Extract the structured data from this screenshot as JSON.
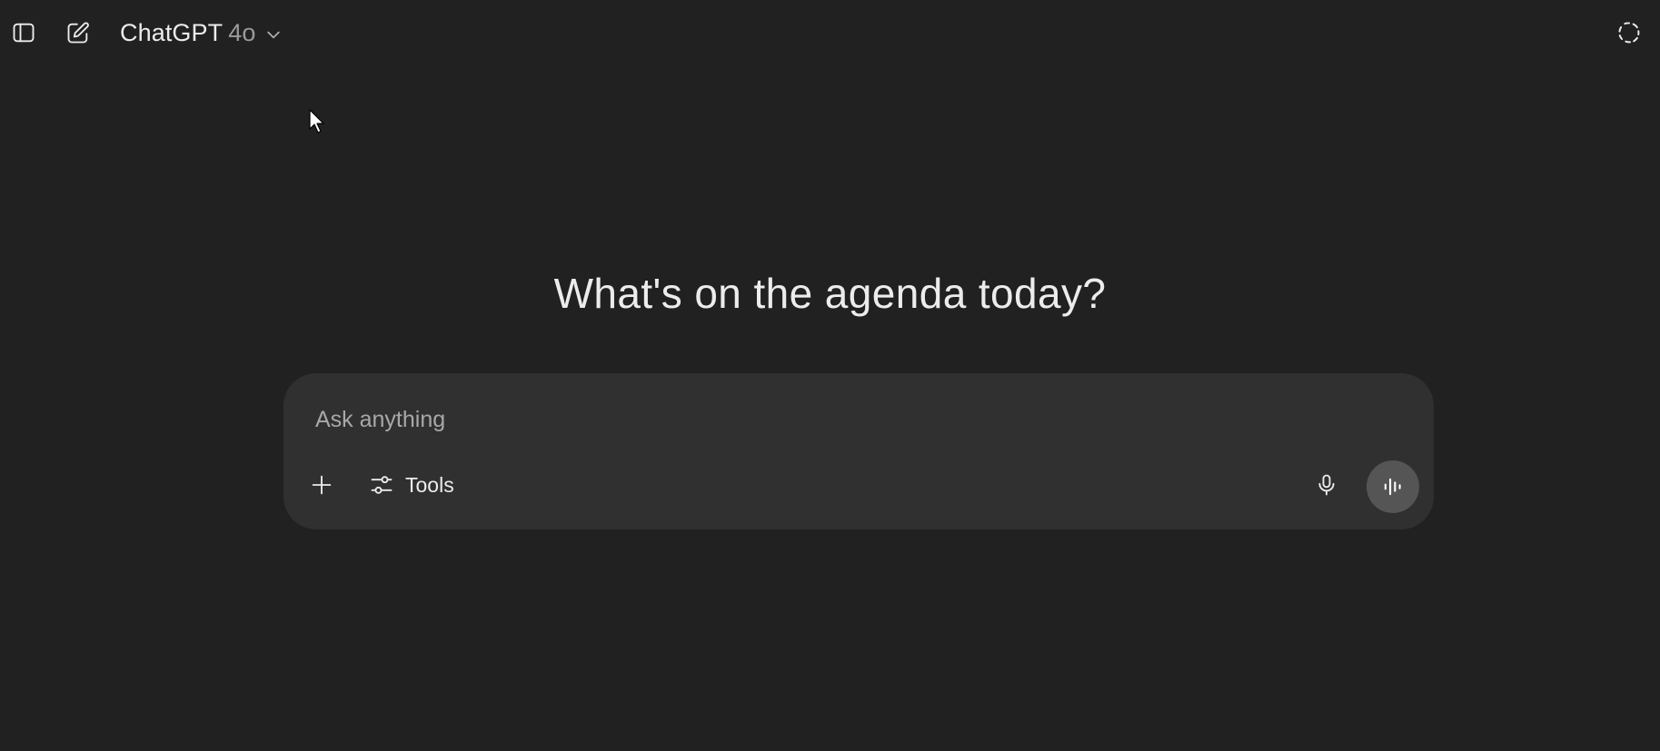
{
  "header": {
    "sidebar_toggle_icon": "sidebar-icon",
    "new_chat_icon": "edit-icon",
    "model_name": "ChatGPT",
    "model_version": "4o",
    "model_chevron_icon": "chevron-down-icon",
    "temporary_chat_icon": "dashed-circle-icon"
  },
  "main": {
    "heading": "What's on the agenda today?"
  },
  "composer": {
    "placeholder": "Ask anything",
    "value": "",
    "add_icon": "plus-icon",
    "tools_icon": "sliders-icon",
    "tools_label": "Tools",
    "mic_icon": "microphone-icon",
    "voice_icon": "voice-waveform-icon"
  },
  "colors": {
    "background": "#212121",
    "composer_background": "#303030",
    "text": "#ececec",
    "muted_text": "#9b9b9b",
    "voice_button": "#555555"
  }
}
